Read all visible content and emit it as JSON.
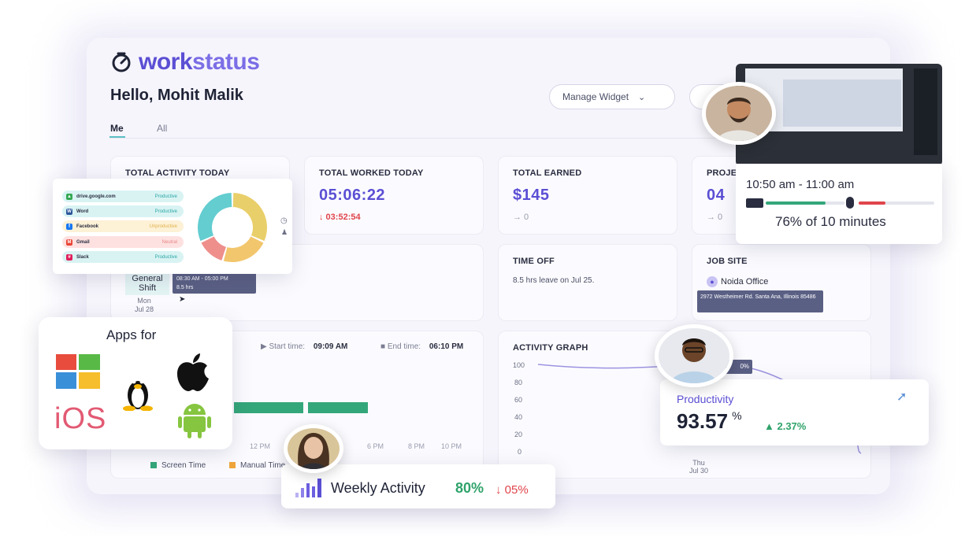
{
  "brand": {
    "name_part1": "work",
    "name_part2": "status"
  },
  "header": {
    "greeting": "Hello, Mohit Malik",
    "manage_widget": "Manage Widget"
  },
  "tabs": [
    "Me",
    "All"
  ],
  "cards": {
    "activity_today": {
      "title": "TOTAL ACTIVITY TODAY"
    },
    "worked_today": {
      "title": "TOTAL WORKED TODAY",
      "value": "05:06:22",
      "sub": "↓ 03:52:54"
    },
    "earned": {
      "title": "TOTAL EARNED",
      "value": "$145",
      "sub": "→ 0"
    },
    "projects": {
      "title": "PROJE",
      "value": "04",
      "sub": "→ 0"
    },
    "time_off": {
      "title": "TIME OFF",
      "text": "8.5 hrs leave on Jul 25."
    },
    "job_site": {
      "title": "JOB SITE",
      "location": "Noida Office",
      "address": "2972 Westheimer Rd. Santa Ana, Illinois 85486"
    },
    "activity_graph": {
      "title": "ACTIVITY GRAPH",
      "y_ticks": [
        "100",
        "80",
        "60",
        "40",
        "20",
        "0"
      ],
      "x_day": "Thu",
      "x_date": "Jul 30",
      "badge": "0%"
    }
  },
  "shift": {
    "name_line1": "General",
    "name_line2": "Shift",
    "hours": "08:30 AM - 05:00 PM",
    "duration": "8.5 hrs",
    "day": "Mon",
    "date": "Jul 28"
  },
  "timeline": {
    "start_label": "Start time:",
    "start_value": "09:09 AM",
    "end_label": "End time:",
    "end_value": "06:10 PM",
    "ticks": [
      "12 PM",
      "6 PM",
      "8 PM",
      "10 PM"
    ],
    "legend": [
      "Screen Time",
      "Manual Time"
    ]
  },
  "apps_popup": {
    "apps": [
      {
        "name": "drive.google.com",
        "status": "Productive",
        "icon": "google-drive-icon",
        "color": "#d9f3f3",
        "status_color": "#2aa7a5"
      },
      {
        "name": "Word",
        "status": "Productive",
        "icon": "word-icon",
        "color": "#d9f3f3",
        "status_color": "#2aa7a5"
      },
      {
        "name": "Facebook",
        "status": "Unproductive",
        "icon": "facebook-icon",
        "color": "#fdf1d6",
        "status_color": "#e2b24a"
      },
      {
        "name": "Gmail",
        "status": "Neutral",
        "icon": "gmail-icon",
        "color": "#fde1e1",
        "status_color": "#e98585"
      },
      {
        "name": "Slack",
        "status": "Productive",
        "icon": "slack-icon",
        "color": "#d9f3f3",
        "status_color": "#2aa7a5"
      }
    ],
    "donut": [
      {
        "label": "Productive",
        "value": 35,
        "color": "#e9cf6a"
      },
      {
        "label": "Unproductive",
        "value": 25,
        "color": "#f2c66d"
      },
      {
        "label": "Neutral",
        "value": 15,
        "color": "#ee8f8c"
      },
      {
        "label": "Other",
        "value": 35,
        "color": "#63cdd0"
      }
    ]
  },
  "platforms": {
    "title": "Apps for",
    "ios": "iOS"
  },
  "screenshot_popup": {
    "time_range": "10:50 am - 11:00 am",
    "summary": "76% of 10 minutes",
    "keyboard_pct": 0.76,
    "mouse_pct": 0.35
  },
  "productivity": {
    "label": "Productivity",
    "value": "93.57",
    "unit": "%",
    "change": "▲ 2.37%"
  },
  "weekly": {
    "label": "Weekly Activity",
    "value": "80%",
    "change": "↓ 05%"
  },
  "colors": {
    "accent": "#5b4fd4",
    "green": "#2fa36b",
    "red": "#e0454b",
    "teal": "#5bc0c4"
  }
}
